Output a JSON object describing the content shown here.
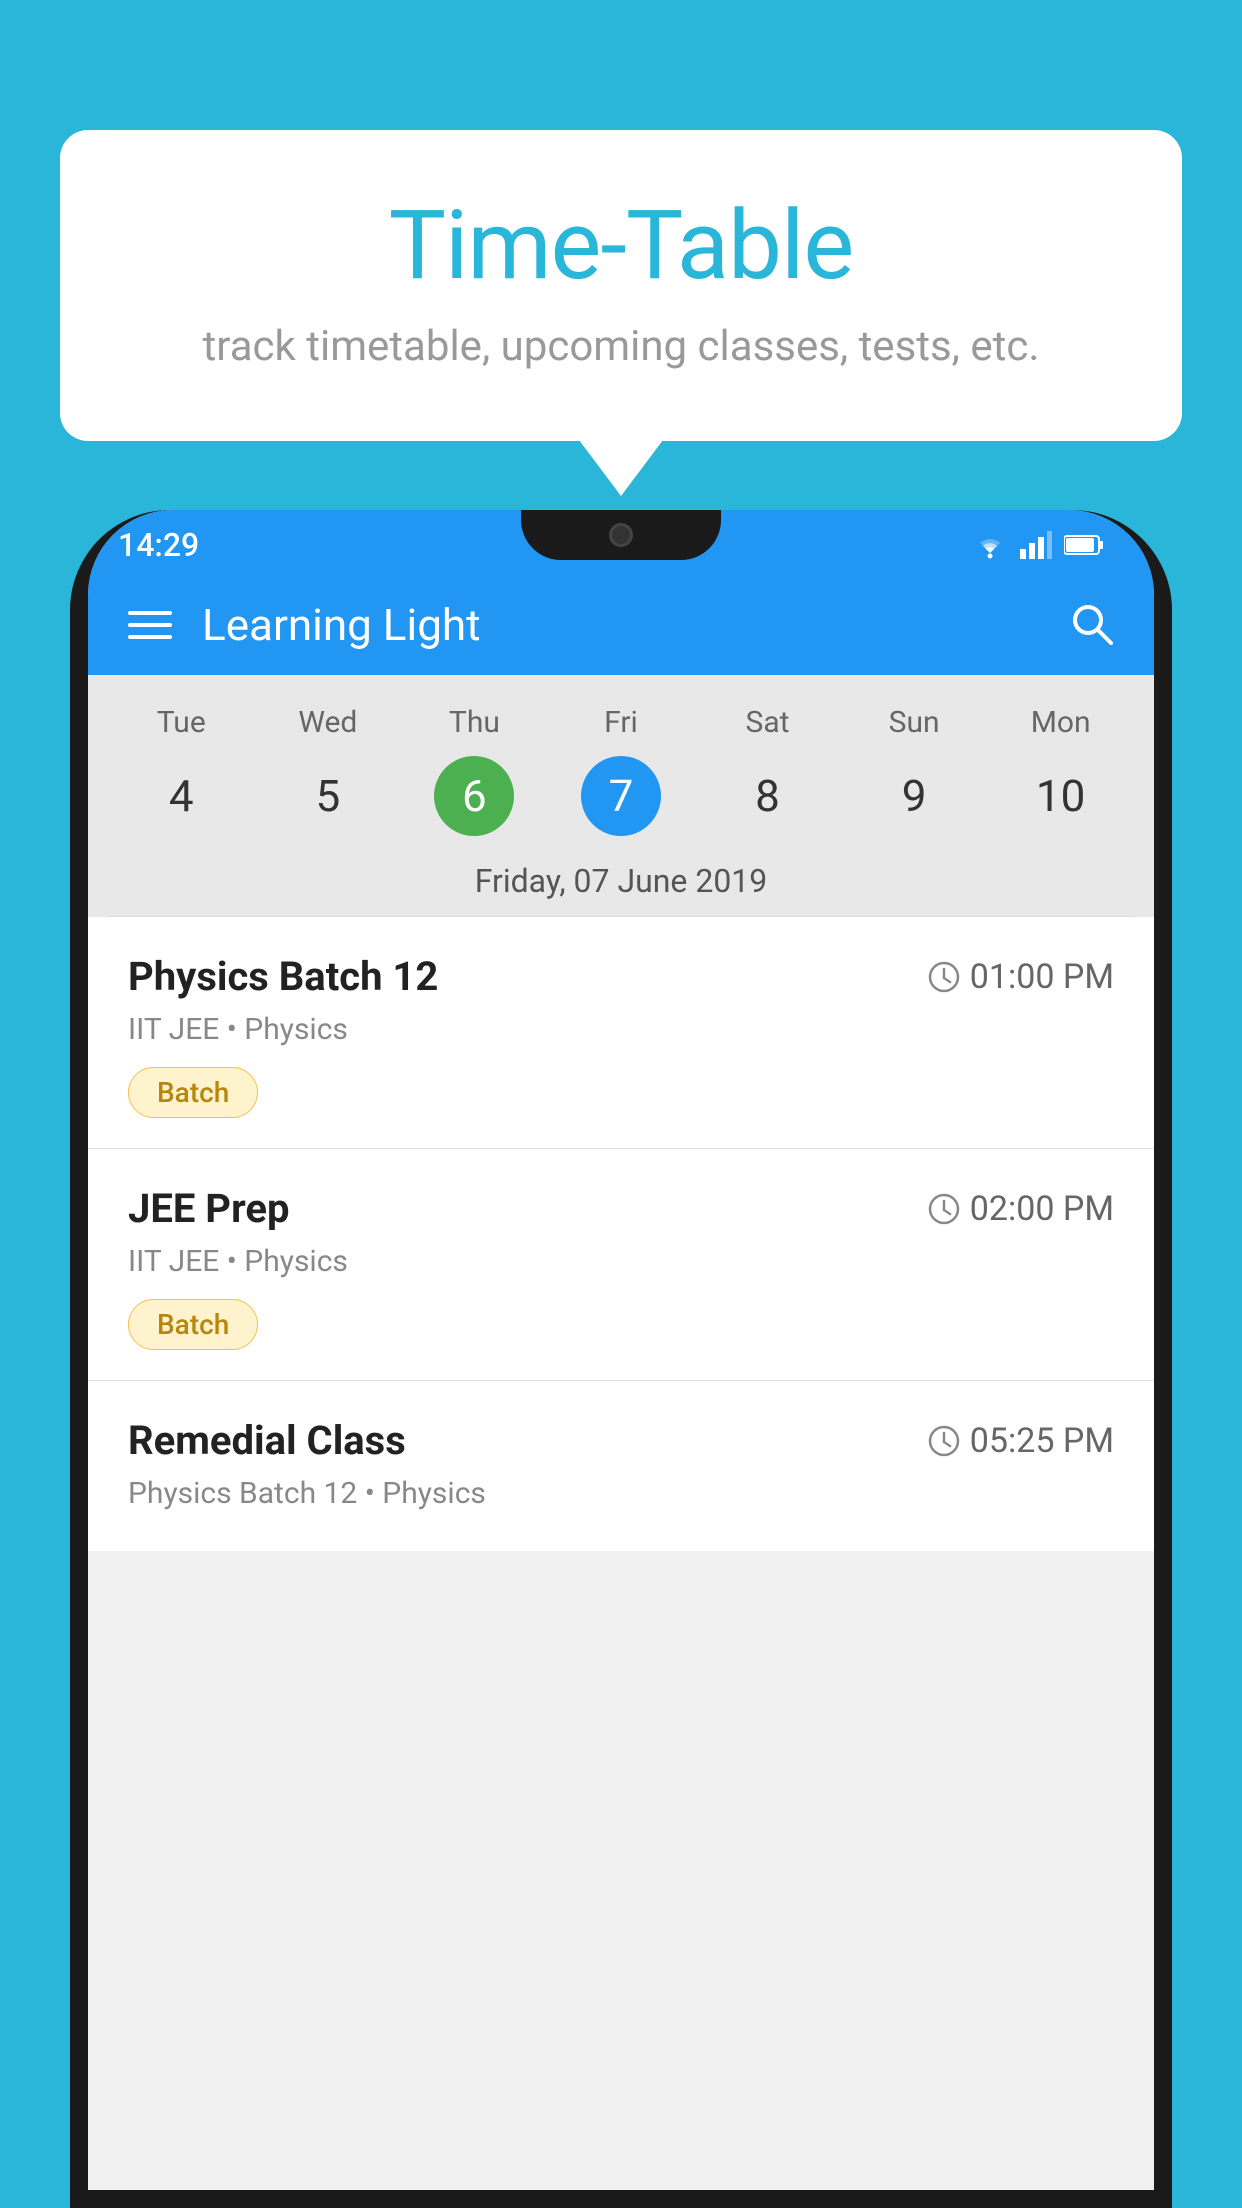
{
  "background_color": "#29B6D8",
  "speech_bubble": {
    "title": "Time-Table",
    "subtitle": "track timetable, upcoming classes, tests, etc."
  },
  "phone": {
    "status_bar": {
      "time": "14:29"
    },
    "app_header": {
      "title": "Learning Light"
    },
    "calendar": {
      "days": [
        {
          "name": "Tue",
          "num": "4",
          "state": "normal"
        },
        {
          "name": "Wed",
          "num": "5",
          "state": "normal"
        },
        {
          "name": "Thu",
          "num": "6",
          "state": "today"
        },
        {
          "name": "Fri",
          "num": "7",
          "state": "selected"
        },
        {
          "name": "Sat",
          "num": "8",
          "state": "normal"
        },
        {
          "name": "Sun",
          "num": "9",
          "state": "normal"
        },
        {
          "name": "Mon",
          "num": "10",
          "state": "normal"
        }
      ],
      "selected_date_label": "Friday, 07 June 2019"
    },
    "schedule_items": [
      {
        "title": "Physics Batch 12",
        "time": "01:00 PM",
        "subtitle": "IIT JEE • Physics",
        "badge": "Batch"
      },
      {
        "title": "JEE Prep",
        "time": "02:00 PM",
        "subtitle": "IIT JEE • Physics",
        "badge": "Batch"
      },
      {
        "title": "Remedial Class",
        "time": "05:25 PM",
        "subtitle": "Physics Batch 12 • Physics"
      }
    ]
  }
}
